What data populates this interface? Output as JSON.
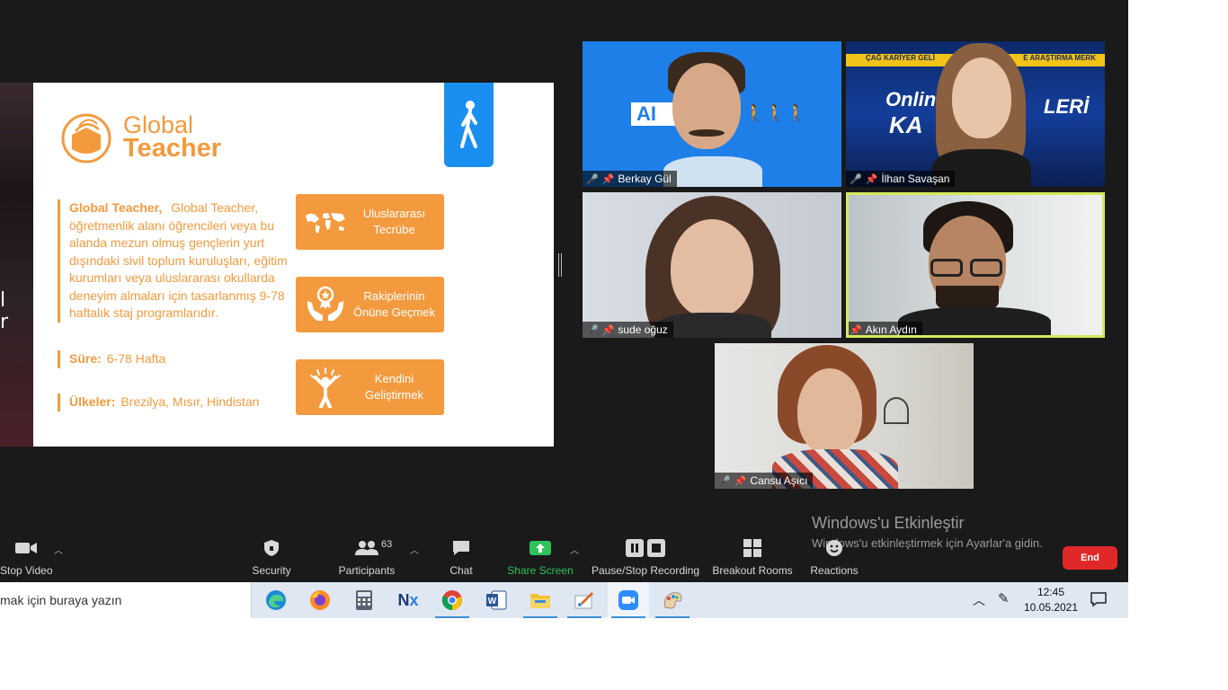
{
  "slide": {
    "logo_line1": "Global",
    "logo_line2": "Teacher",
    "desc_bold": "Global Teacher,",
    "desc_text": " Global Teacher, öğretmenlik alanı öğrencileri veya bu alanda mezun olmuş gençlerin yurt dışındaki sivil toplum kuruluşları, eğitim kurumları veya uluslararası okullarda deneyim almaları için tasarlanmış 9-78 haftalık staj programlarıdır.",
    "sure_label": "Süre:",
    "sure_value": "6-78 Hafta",
    "ulkeler_label": "Ülkeler:",
    "ulkeler_value": "Brezilya, Mısır, Hindistan",
    "features": [
      {
        "line1": "Uluslararası",
        "line2": "Tecrübe",
        "icon": "world-map-icon"
      },
      {
        "line1": "Rakiplerinin",
        "line2": "Önüne Geçmek",
        "icon": "award-hands-icon"
      },
      {
        "line1": "Kendini",
        "line2": "Geliştirmek",
        "icon": "person-celebrate-icon"
      }
    ],
    "left_strip_chars": [
      "l",
      "r"
    ],
    "accent": "#f39a3e",
    "badge_color": "#1a8ff0"
  },
  "participants_video": [
    {
      "name": "Berkay Gül",
      "muted": true
    },
    {
      "name": "İlhan Savaşan",
      "muted": true
    },
    {
      "name": "sude oğuz",
      "muted": true
    },
    {
      "name": "Akın Aydın",
      "muted": false,
      "active_speaker": true
    },
    {
      "name": "Cansu Aşıcı",
      "muted": true
    }
  ],
  "tile_backgrounds": {
    "berkay_text": "AI",
    "ilhan_banner": "ÇAĞ KARİYER GELİ",
    "ilhan_banner2": "E ARAŞTIRMA MERK",
    "ilhan_text1": "Onlin",
    "ilhan_text2": "KA",
    "ilhan_text3": "LERİ"
  },
  "toolbar": {
    "stop_video": "Stop Video",
    "security": "Security",
    "participants": "Participants",
    "participants_count": "63",
    "chat": "Chat",
    "share_screen": "Share Screen",
    "pause_recording": "Pause/Stop Recording",
    "breakout": "Breakout Rooms",
    "reactions": "Reactions",
    "end": "End",
    "share_color": "#2dc35a",
    "end_color": "#e02828"
  },
  "watermark": {
    "title": "Windows'u Etkinleştir",
    "subtitle": "Windows'u etkinleştirmek için Ayarlar'a gidin."
  },
  "taskbar": {
    "search_text": "mak için buraya yazın",
    "apps": [
      "edge-icon",
      "firefox-icon",
      "calculator-icon",
      "nx-icon",
      "chrome-icon",
      "word-icon",
      "file-explorer-icon",
      "paint-icon",
      "zoom-icon",
      "paint3d-icon"
    ],
    "time": "12:45",
    "date": "10.05.2021"
  }
}
